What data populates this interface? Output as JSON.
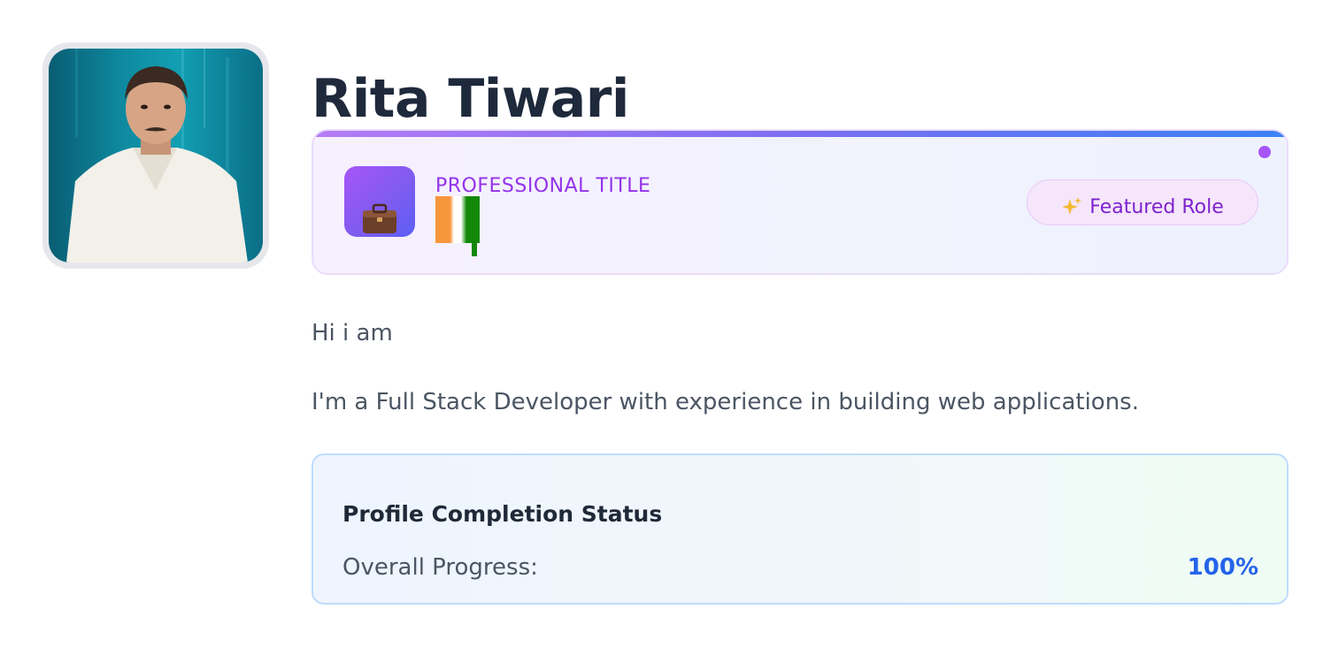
{
  "profile": {
    "name": "Rita Tiwari",
    "greeting": "Hi i am",
    "bio": "I'm a Full Stack Developer with experience in building web applications."
  },
  "title_card": {
    "label": "PROFESSIONAL TITLE",
    "featured_badge": "Featured Role",
    "icon": "briefcase-icon",
    "flag_icon": "india-flag-icon",
    "badge_icon": "sparkles-icon"
  },
  "completion": {
    "title": "Profile Completion Status",
    "progress_label": "Overall Progress:",
    "progress_value": "100%"
  },
  "colors": {
    "accent_purple": "#9333ea",
    "accent_blue": "#2563eb",
    "heading": "#1e293b"
  }
}
